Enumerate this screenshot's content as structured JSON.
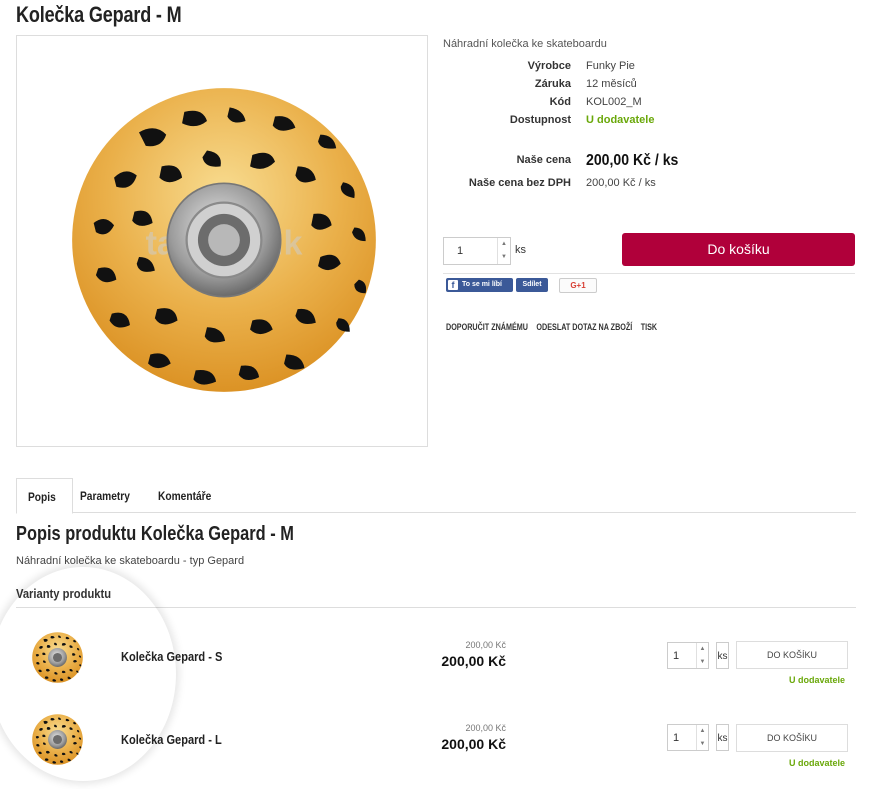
{
  "product": {
    "title": "Kolečka Gepard - M",
    "short_description": "Náhradní kolečka ke skateboardu",
    "watermark": "tajCentrik",
    "params": [
      {
        "key": "Výrobce",
        "value": "Funky Pie"
      },
      {
        "key": "Záruka",
        "value": "12 měsíců"
      },
      {
        "key": "Kód",
        "value": "KOL002_M"
      },
      {
        "key": "Dostupnost",
        "value": "U dodavatele"
      }
    ],
    "price_label": "Naše cena",
    "price_value": "200,00 Kč / ks",
    "price_novat_label": "Naše cena bez DPH",
    "price_novat_value": "200,00 Kč / ks"
  },
  "buy": {
    "quantity": "1",
    "unit": "ks",
    "button_label": "Do košíku"
  },
  "social": {
    "fb_like": "To se mi líbí",
    "fb_share": "Sdílet",
    "gplus": "G+1"
  },
  "actions": [
    "DOPORUČIT ZNÁMÉMU",
    "ODESLAT DOTAZ NA ZBOŽÍ",
    "TISK"
  ],
  "tabs": [
    "Popis",
    "Parametry",
    "Komentáře"
  ],
  "description": {
    "title": "Popis produktu Kolečka Gepard - M",
    "text": "Náhradní kolečka ke skateboardu - typ Gepard"
  },
  "variants_title": "Varianty produktu",
  "variants": [
    {
      "name": "Kolečka Gepard - S",
      "price_small": "200,00 Kč",
      "price": "200,00 Kč",
      "quantity": "1",
      "unit": "ks",
      "button": "DO KOŠÍKU",
      "availability": "U dodavatele"
    },
    {
      "name": "Kolečka Gepard - L",
      "price_small": "200,00 Kč",
      "price": "200,00 Kč",
      "quantity": "1",
      "unit": "ks",
      "button": "DO KOŠÍKU",
      "availability": "U dodavatele"
    }
  ],
  "colors": {
    "buy_button": "#b0003a",
    "availability": "#6aa80a",
    "facebook": "#3b5998",
    "wheel_gold": "#e8a93a"
  }
}
